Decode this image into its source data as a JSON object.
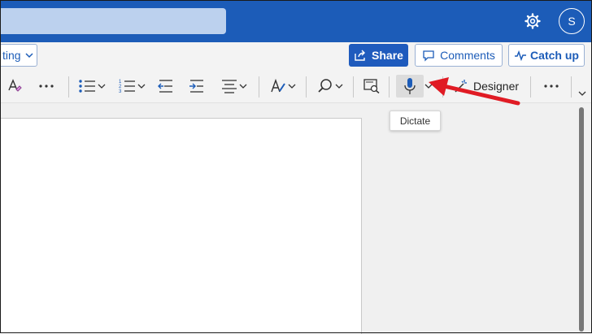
{
  "header": {
    "avatar_initial": "S",
    "icons": [
      "gear-icon"
    ]
  },
  "toolbar": {
    "mode_label_partial": "ting",
    "share_label": "Share",
    "comments_label": "Comments",
    "catchup_label": "Catch up"
  },
  "ribbon": {
    "designer_label": "Designer",
    "icons": [
      "clear-formatting-icon",
      "more-icon",
      "bullets-icon",
      "numbering-icon",
      "decrease-indent-icon",
      "increase-indent-icon",
      "align-icon",
      "styles-icon",
      "find-icon",
      "immersive-reader-icon",
      "microphone-icon",
      "designer-icon",
      "more-icon"
    ]
  },
  "tooltip": {
    "text": "Dictate"
  },
  "colors": {
    "titlebar": "#1c5cb8",
    "accent": "#1f5bbd",
    "arrow": "#e01b24"
  }
}
